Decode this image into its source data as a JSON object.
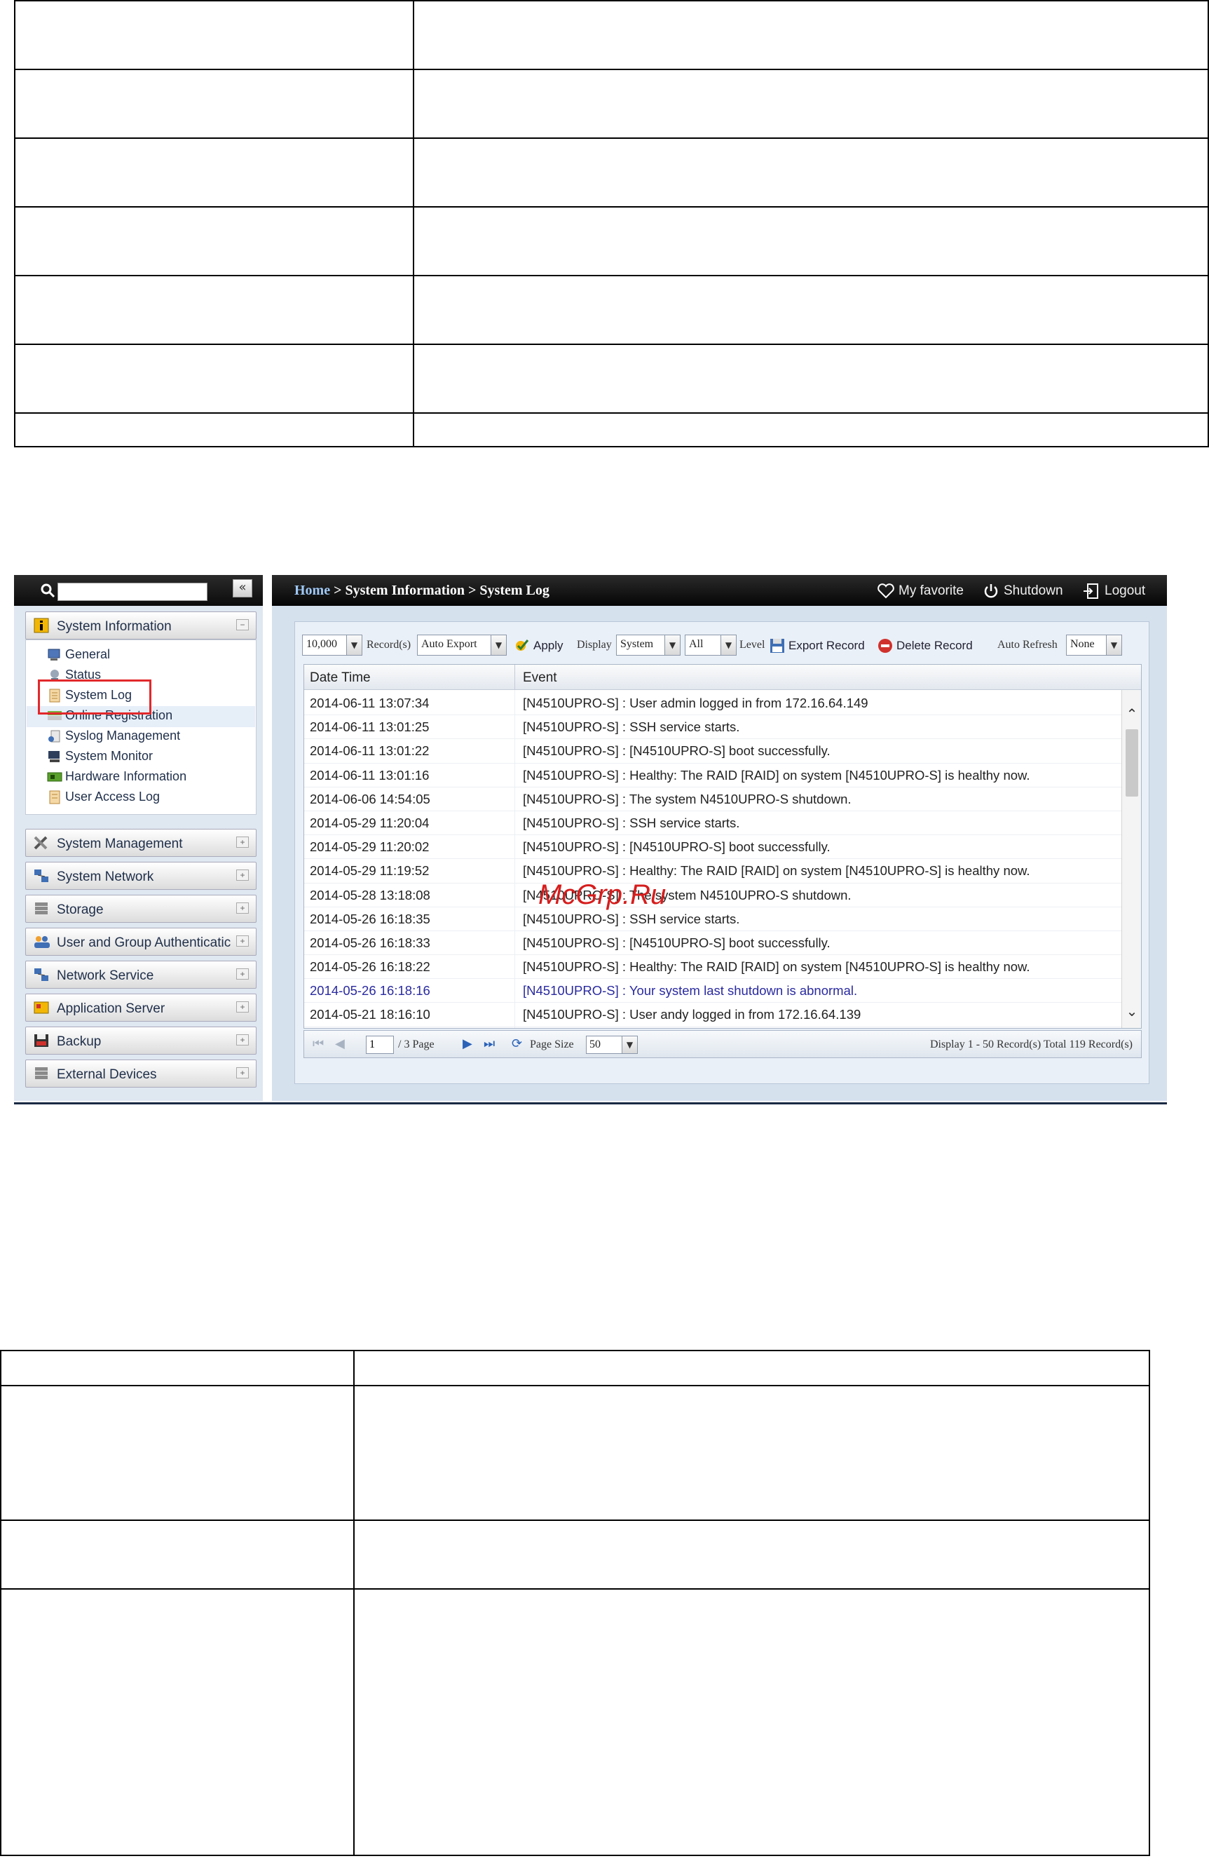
{
  "left_panel": {
    "search_placeholder": "",
    "collapse_label": "«",
    "sections": [
      {
        "label": "System Information",
        "icon": "info-icon",
        "toggle": "−"
      },
      {
        "label": "System Management",
        "icon": "tools-icon",
        "toggle": "+"
      },
      {
        "label": "System Network",
        "icon": "network-icon",
        "toggle": "+"
      },
      {
        "label": "Storage",
        "icon": "storage-icon",
        "toggle": "+"
      },
      {
        "label": "User and Group Authenticatic",
        "icon": "users-icon",
        "toggle": "+"
      },
      {
        "label": "Network Service",
        "icon": "network-service-icon",
        "toggle": "+"
      },
      {
        "label": "Application Server",
        "icon": "application-icon",
        "toggle": "+"
      },
      {
        "label": "Backup",
        "icon": "backup-icon",
        "toggle": "+"
      },
      {
        "label": "External Devices",
        "icon": "devices-icon",
        "toggle": "+"
      }
    ],
    "tree_items": [
      {
        "label": "General",
        "icon": "general-icon"
      },
      {
        "label": "Status",
        "icon": "status-icon"
      },
      {
        "label": "System Log",
        "icon": "log-icon"
      },
      {
        "label": "Online Registration",
        "icon": "registration-icon"
      },
      {
        "label": "Syslog Management",
        "icon": "syslog-icon"
      },
      {
        "label": "System Monitor",
        "icon": "monitor-icon"
      },
      {
        "label": "Hardware Information",
        "icon": "hardware-icon"
      },
      {
        "label": "User Access Log",
        "icon": "access-log-icon"
      }
    ],
    "selected_item": "System Log"
  },
  "topbar": {
    "crumb_home": "Home",
    "crumb_rest": " > System Information > System Log",
    "favorite": "My favorite",
    "shutdown": "Shutdown",
    "logout": "Logout"
  },
  "toolbar": {
    "records_value": "10,000",
    "records_label": "Record(s)",
    "export_mode": "Auto Export",
    "apply": "Apply",
    "display_label": "Display",
    "display_value": "System",
    "level_value": "All",
    "level_label": "Level",
    "export_record": "Export Record",
    "delete_record": "Delete Record",
    "auto_refresh_label": "Auto Refresh",
    "auto_refresh_value": "None"
  },
  "grid": {
    "columns": [
      "Date Time",
      "Event"
    ],
    "rows": [
      {
        "date": "2014-06-11 13:07:34",
        "event": "[N4510UPRO-S] : User admin logged in from 172.16.64.149",
        "alert": false
      },
      {
        "date": "2014-06-11 13:01:25",
        "event": "[N4510UPRO-S] : SSH service starts.",
        "alert": false
      },
      {
        "date": "2014-06-11 13:01:22",
        "event": "[N4510UPRO-S] : [N4510UPRO-S] boot successfully.",
        "alert": false
      },
      {
        "date": "2014-06-11 13:01:16",
        "event": "[N4510UPRO-S] : Healthy: The RAID [RAID] on system [N4510UPRO-S] is healthy now.",
        "alert": false
      },
      {
        "date": "2014-06-06 14:54:05",
        "event": "[N4510UPRO-S] : The system N4510UPRO-S shutdown.",
        "alert": false
      },
      {
        "date": "2014-05-29 11:20:04",
        "event": "[N4510UPRO-S] : SSH service starts.",
        "alert": false
      },
      {
        "date": "2014-05-29 11:20:02",
        "event": "[N4510UPRO-S] : [N4510UPRO-S] boot successfully.",
        "alert": false
      },
      {
        "date": "2014-05-29 11:19:52",
        "event": "[N4510UPRO-S] : Healthy: The RAID [RAID] on system [N4510UPRO-S] is healthy now.",
        "alert": false
      },
      {
        "date": "2014-05-28 13:18:08",
        "event": "[N4510UPRO-S] : The system N4510UPRO-S shutdown.",
        "alert": false
      },
      {
        "date": "2014-05-26 16:18:35",
        "event": "[N4510UPRO-S] : SSH service starts.",
        "alert": false
      },
      {
        "date": "2014-05-26 16:18:33",
        "event": "[N4510UPRO-S] : [N4510UPRO-S] boot successfully.",
        "alert": false
      },
      {
        "date": "2014-05-26 16:18:22",
        "event": "[N4510UPRO-S] : Healthy: The RAID [RAID] on system [N4510UPRO-S] is healthy now.",
        "alert": false
      },
      {
        "date": "2014-05-26 16:18:16",
        "event": "[N4510UPRO-S] : Your system last shutdown is abnormal.",
        "alert": true
      },
      {
        "date": "2014-05-21 18:16:10",
        "event": "[N4510UPRO-S] : User andy logged in from 172.16.64.139",
        "alert": false
      }
    ]
  },
  "pager": {
    "page_value": "1",
    "page_total": "/ 3 Page",
    "page_size_label": "Page Size",
    "page_size_value": "50",
    "display_text": "Display 1 - 50 Record(s) Total 119 Record(s)"
  },
  "watermark": "McGrp.Ru",
  "colors": {
    "alert_row": "#2a2aa0",
    "selection_box": "#e2282a",
    "topbar": "#0b0b0b",
    "panel_bg": "#d6e1ee"
  }
}
